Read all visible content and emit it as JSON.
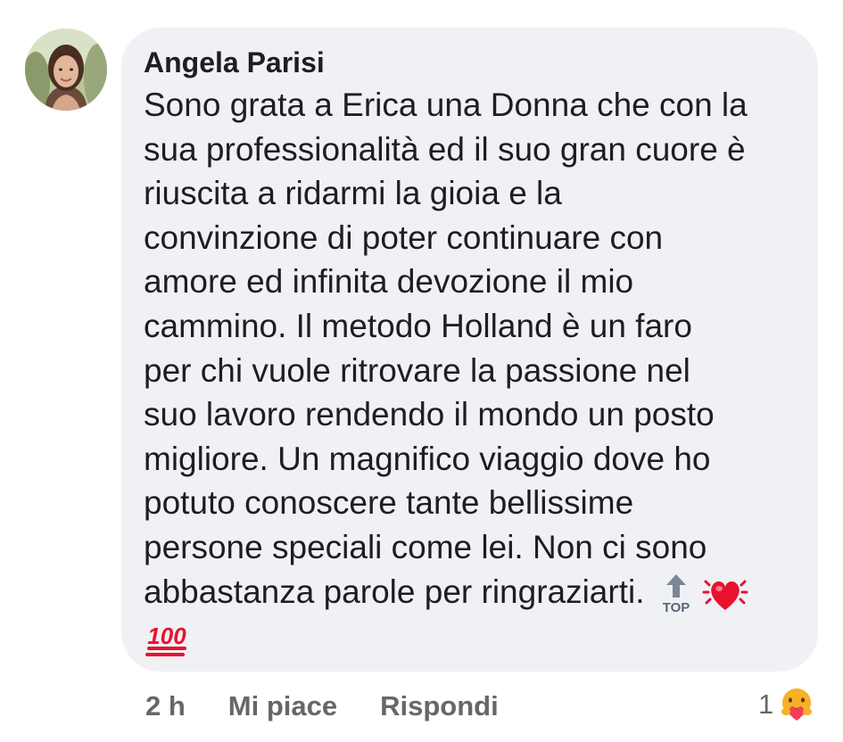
{
  "comment": {
    "author": "Angela Parisi",
    "text_lines": [
      "Sono grata a Erica una  Donna che con la",
      "sua professionalità ed il suo gran cuore è",
      "riuscita a ridarmi la gioia e la",
      "convinzione di poter continuare con",
      "amore ed infinita devozione il mio",
      "cammino. Il metodo Holland è un faro",
      "per chi vuole ritrovare la passione nel",
      "suo lavoro rendendo il mondo un posto",
      "migliore. Un magnifico viaggio dove ho",
      "potuto conoscere tante bellissime",
      "persone speciali come lei. Non ci sono",
      "abbastanza parole per ringraziarti."
    ],
    "emojis": [
      "top-arrow-emoji",
      "beating-heart-emoji",
      "hundred-points-emoji"
    ],
    "top_emoji_text": "TOP",
    "hundred_emoji_text": "100"
  },
  "actions": {
    "time": "2 h",
    "like_label": "Mi piace",
    "reply_label": "Rispondi"
  },
  "reactions": {
    "count": "1",
    "icon": "care-reaction-icon"
  },
  "colors": {
    "bubble": "#f0f1f5",
    "text": "#1c1e21",
    "meta": "#65676b",
    "heart": "#e8122e",
    "hundred": "#e8122e",
    "care": "#f7b125"
  }
}
